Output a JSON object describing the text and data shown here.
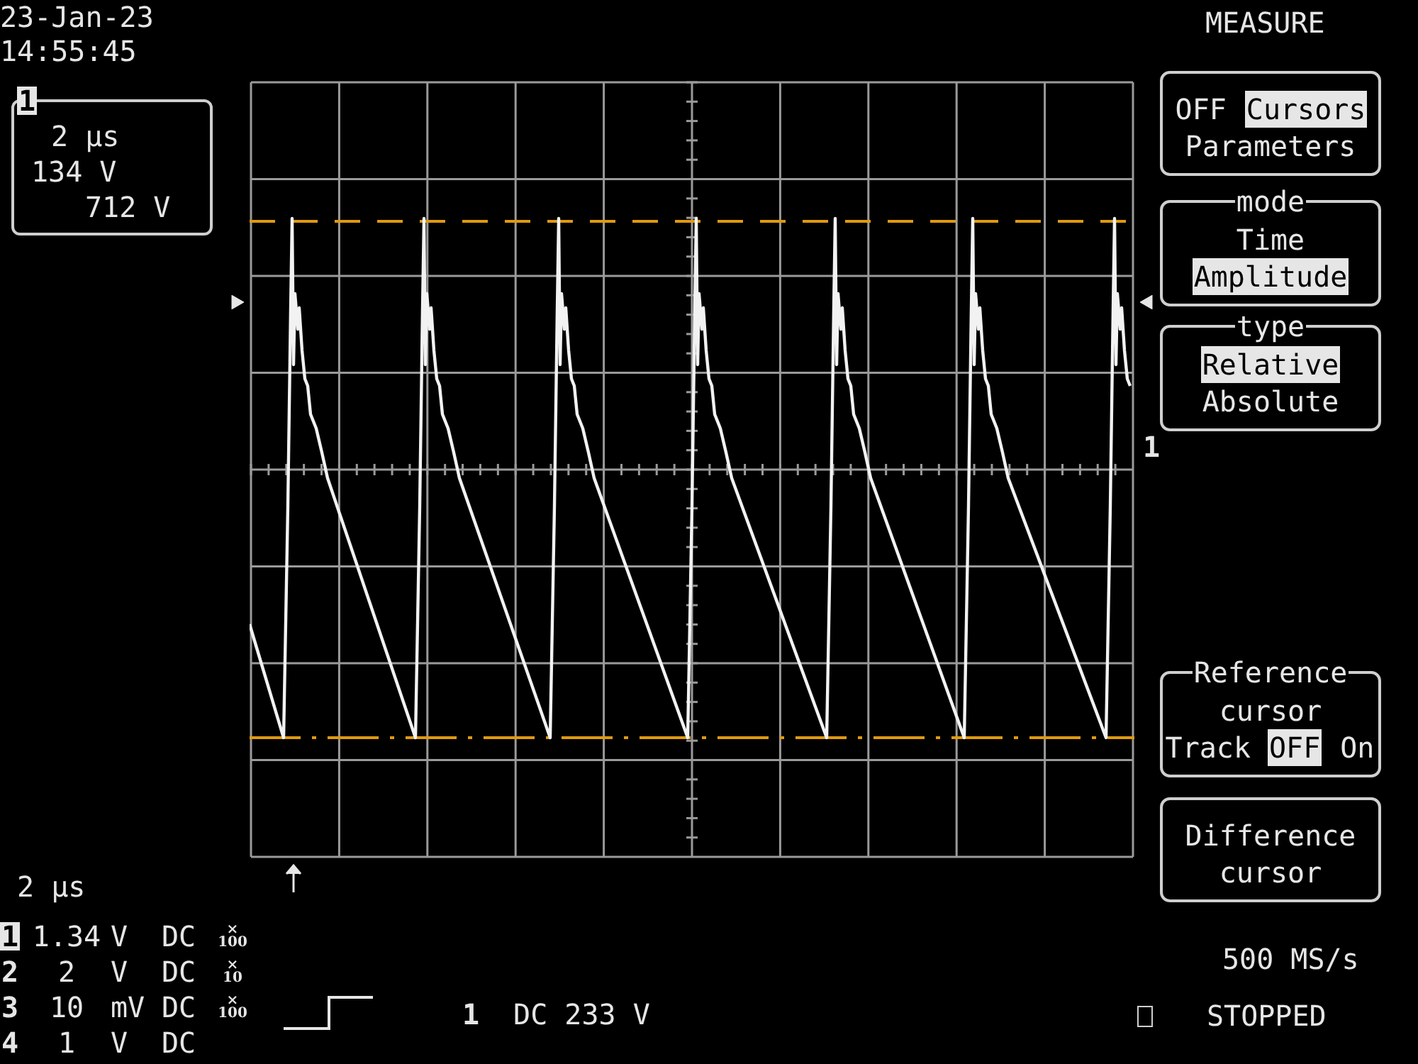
{
  "clock": {
    "date": "23-Jan-23",
    "time": "14:55:45"
  },
  "trace_label": {
    "channel": "1",
    "lines": [
      "2 μs",
      "134 V",
      "712 V"
    ]
  },
  "scope": {
    "channel_marker": "1"
  },
  "timebase": "2 μs",
  "channels": [
    {
      "number": "1",
      "selected": true,
      "value": "1.34",
      "unit": "V",
      "coupling": "DC",
      "probe_sign": "×",
      "probe": "100"
    },
    {
      "number": "2",
      "selected": false,
      "value": "2",
      "unit": "V",
      "coupling": "DC",
      "probe_sign": "×",
      "probe": "10"
    },
    {
      "number": "3",
      "selected": false,
      "value": "10",
      "unit": "mV",
      "coupling": "DC",
      "probe_sign": "×",
      "probe": "100"
    },
    {
      "number": "4",
      "selected": false,
      "value": "1",
      "unit": "V",
      "coupling": "DC"
    }
  ],
  "trigger": {
    "source": "1",
    "setting": "DC 233 V"
  },
  "menu": {
    "title": "MEASURE",
    "panels": [
      {
        "lines": [
          {
            "options": [
              {
                "label": "OFF",
                "selected": false
              },
              {
                "label": "Cursors",
                "selected": true
              }
            ]
          },
          {
            "options": [
              {
                "label": "Parameters",
                "selected": false
              }
            ]
          }
        ]
      },
      {
        "heading": "mode",
        "lines": [
          {
            "options": [
              {
                "label": "Time",
                "selected": false
              }
            ]
          },
          {
            "options": [
              {
                "label": "Amplitude",
                "selected": true
              }
            ]
          }
        ]
      },
      {
        "heading": "type",
        "lines": [
          {
            "options": [
              {
                "label": "Relative",
                "selected": true
              }
            ]
          },
          {
            "options": [
              {
                "label": "Absolute",
                "selected": false
              }
            ]
          }
        ]
      },
      {
        "heading": "Reference",
        "lines": [
          {
            "label": "cursor"
          },
          {
            "label": "Track",
            "options": [
              {
                "label": "OFF",
                "selected": true
              },
              {
                "label": "On",
                "selected": false
              }
            ]
          }
        ]
      },
      {
        "lines": [
          {
            "label": "Difference"
          },
          {
            "label": "cursor"
          }
        ]
      }
    ]
  },
  "sample_rate": "500 MS/s",
  "status": "STOPPED"
}
